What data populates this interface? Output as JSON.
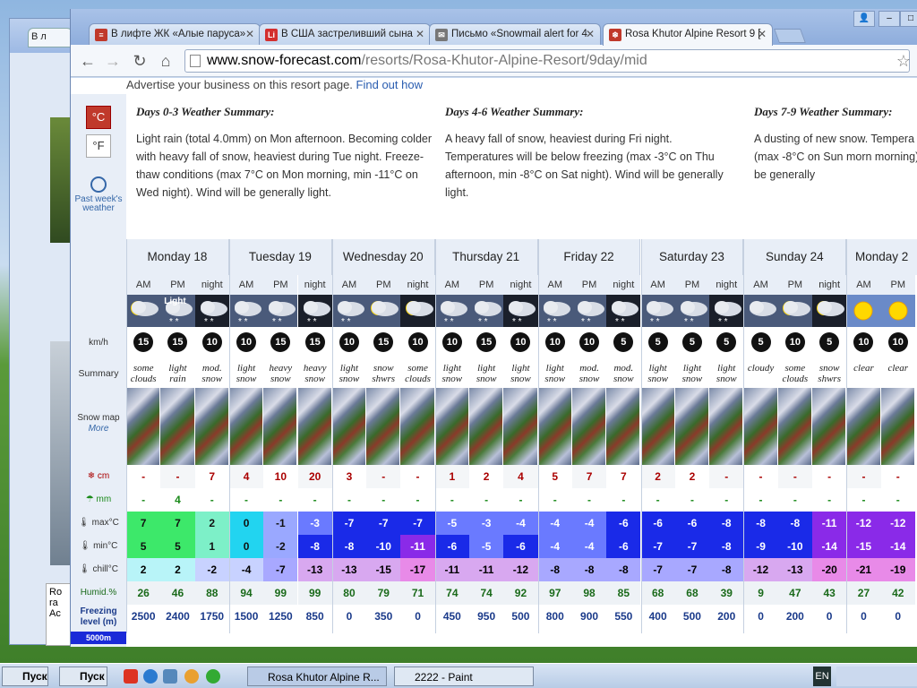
{
  "background_window": {
    "tab_label": "В л",
    "box_text": "Ro ra",
    "box_text2": "Ac"
  },
  "tabs": [
    {
      "label": "В лифте ЖК «Алые паруса»",
      "fav_color": "#c0392b",
      "fav_glyph": "≡"
    },
    {
      "label": "В США застреливший сына",
      "fav_color": "#d32f2f",
      "fav_glyph": "Li"
    },
    {
      "label": "Письмо «Snowmail alert for 4",
      "fav_color": "#777777",
      "fav_glyph": "✉"
    },
    {
      "label": "Rosa Khutor Alpine Resort 9 [",
      "fav_color": "#c0392b",
      "fav_glyph": "❄"
    }
  ],
  "address": {
    "domain": "www.snow-forecast.com",
    "path": "/resorts/Rosa-Khutor-Alpine-Resort/9day/mid"
  },
  "advert": {
    "text": "Advertise your business on this resort page.",
    "link": "Find out how"
  },
  "units": {
    "c": "°C",
    "f": "°F"
  },
  "past_week": "Past week's weather",
  "summaries": [
    {
      "title": "Days 0-3 Weather Summary:",
      "body": "Light rain (total 4.0mm) on Mon afternoon. Becoming colder with heavy fall of snow, heaviest during Tue night. Freeze-thaw conditions (max 7°C on Mon morning, min -11°C on Wed night). Wind will be generally light."
    },
    {
      "title": "Days 4-6 Weather Summary:",
      "body": "A heavy fall of snow, heaviest during Fri night. Temperatures will be below freezing (max -3°C on Thu afternoon, min -8°C on Sat night). Wind will be generally light."
    },
    {
      "title": "Days 7-9 Weather Summary:",
      "body": "A dusting of new snow. Tempera freezing (max -8°C on Sun morn morning). Wind will be generally"
    }
  ],
  "row_labels": {
    "wind": "km/h",
    "summary": "Summary",
    "snowmap": "Snow map",
    "more": "More",
    "snow": "cm",
    "rain": "mm",
    "max": "max°C",
    "min": "min°C",
    "chill": "chill°C",
    "humid": "Humid.%",
    "freezing": "Freezing level (m)",
    "legend": "5000m"
  },
  "days": [
    "Monday 18",
    "Tuesday 19",
    "Wednesday 20",
    "Thursday 21",
    "Friday 22",
    "Saturday 23",
    "Sunday 24",
    "Monday 2"
  ],
  "periods": [
    "AM",
    "PM",
    "night",
    "AM",
    "PM",
    "night",
    "AM",
    "PM",
    "night",
    "AM",
    "PM",
    "night",
    "AM",
    "PM",
    "night",
    "AM",
    "PM",
    "night",
    "AM",
    "PM",
    "night",
    "AM",
    "PM"
  ],
  "weather_text": [
    "",
    "Light",
    "",
    "",
    "",
    "",
    "",
    "",
    "",
    "",
    "",
    "",
    "",
    "",
    "",
    "",
    "",
    "",
    "",
    "",
    "",
    "",
    ""
  ],
  "wind": [
    "15",
    "15",
    "10",
    "10",
    "15",
    "15",
    "10",
    "15",
    "10",
    "10",
    "15",
    "10",
    "10",
    "10",
    "5",
    "5",
    "5",
    "5",
    "5",
    "10",
    "5",
    "10",
    "10"
  ],
  "summary": [
    "some clouds",
    "light rain",
    "mod. snow",
    "light snow",
    "heavy snow",
    "heavy snow",
    "light snow",
    "snow shwrs",
    "some clouds",
    "light snow",
    "light snow",
    "light snow",
    "light snow",
    "mod. snow",
    "mod. snow",
    "light snow",
    "light snow",
    "light snow",
    "cloudy",
    "some clouds",
    "snow shwrs",
    "clear",
    "clear"
  ],
  "snow": [
    "-",
    "-",
    "7",
    "4",
    "10",
    "20",
    "3",
    "-",
    "-",
    "1",
    "2",
    "4",
    "5",
    "7",
    "7",
    "2",
    "2",
    "-",
    "-",
    "-",
    "-",
    "-",
    "-"
  ],
  "rain": [
    "-",
    "4",
    "-",
    "-",
    "-",
    "-",
    "-",
    "-",
    "-",
    "-",
    "-",
    "-",
    "-",
    "-",
    "-",
    "-",
    "-",
    "-",
    "-",
    "-",
    "-",
    "-",
    "-"
  ],
  "max": [
    "7",
    "7",
    "2",
    "0",
    "-1",
    "-3",
    "-7",
    "-7",
    "-7",
    "-5",
    "-3",
    "-4",
    "-4",
    "-4",
    "-6",
    "-6",
    "-6",
    "-8",
    "-8",
    "-8",
    "-11",
    "-12",
    "-12"
  ],
  "min": [
    "5",
    "5",
    "1",
    "0",
    "-2",
    "-8",
    "-8",
    "-10",
    "-11",
    "-6",
    "-5",
    "-6",
    "-4",
    "-4",
    "-6",
    "-7",
    "-7",
    "-8",
    "-9",
    "-10",
    "-14",
    "-15",
    "-14"
  ],
  "chill": [
    "2",
    "2",
    "-2",
    "-4",
    "-7",
    "-13",
    "-13",
    "-15",
    "-17",
    "-11",
    "-11",
    "-12",
    "-8",
    "-8",
    "-8",
    "-7",
    "-7",
    "-8",
    "-12",
    "-13",
    "-20",
    "-21",
    "-19"
  ],
  "humid": [
    "26",
    "46",
    "88",
    "94",
    "99",
    "99",
    "80",
    "79",
    "71",
    "74",
    "74",
    "92",
    "97",
    "98",
    "85",
    "68",
    "68",
    "39",
    "9",
    "47",
    "43",
    "27",
    "42"
  ],
  "freezing": [
    "2500",
    "2400",
    "1750",
    "1500",
    "1250",
    "850",
    "0",
    "350",
    "0",
    "450",
    "950",
    "500",
    "800",
    "900",
    "550",
    "400",
    "500",
    "200",
    "0",
    "200",
    "0",
    "0",
    "0"
  ],
  "taskbar": {
    "start1": "Пуск",
    "start2": "Пуск",
    "tasks": [
      "Rosa Khutor Alpine R...",
      "2222 - Paint"
    ],
    "lang": "EN"
  },
  "colors": {
    "accent": "#c0392b",
    "link": "#2a5db0"
  }
}
